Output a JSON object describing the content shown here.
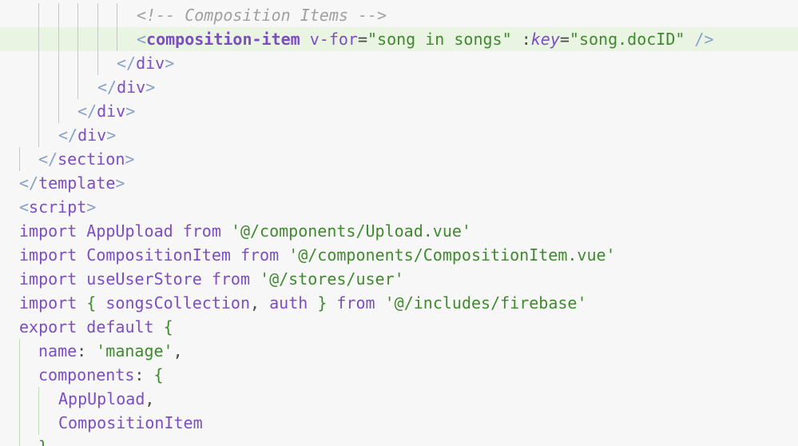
{
  "editor": {
    "line1": {
      "comment": "<!-- Composition Items -->"
    },
    "line2": {
      "open": "<",
      "tag": "composition-item",
      "attr1": "v-for",
      "eq1": "=",
      "val1": "\"song in songs\"",
      "colon": ":",
      "attr2": "key",
      "eq2": "=",
      "val2": "\"song.docID\"",
      "close": "/>"
    },
    "line3": {
      "open": "</",
      "tag": "div",
      "close": ">"
    },
    "line4": {
      "open": "</",
      "tag": "div",
      "close": ">"
    },
    "line5": {
      "open": "</",
      "tag": "div",
      "close": ">"
    },
    "line6": {
      "open": "</",
      "tag": "div",
      "close": ">"
    },
    "line7": {
      "open": "</",
      "tag": "section",
      "close": ">"
    },
    "line8": {
      "open": "</",
      "tag": "template",
      "close": ">"
    },
    "line9": {
      "open": "<",
      "tag": "script",
      "close": ">"
    },
    "line10": {
      "kw1": "import",
      "ident": "AppUpload",
      "kw2": "from",
      "str": "'@/components/Upload.vue'"
    },
    "line11": {
      "kw1": "import",
      "ident": "CompositionItem",
      "kw2": "from",
      "str": "'@/components/CompositionItem.vue'"
    },
    "line12": {
      "kw1": "import",
      "ident": "useUserStore",
      "kw2": "from",
      "str": "'@/stores/user'"
    },
    "line13": {
      "kw1": "import",
      "brace_open": "{",
      "ident1": "songsCollection",
      "comma": ",",
      "ident2": "auth",
      "brace_close": "}",
      "kw2": "from",
      "str": "'@/includes/firebase'"
    },
    "line14": {
      "kw1": "export",
      "kw2": "default",
      "brace": "{"
    },
    "line15": {
      "prop": "name",
      "colon": ":",
      "str": "'manage'",
      "comma": ","
    },
    "line16": {
      "prop": "components",
      "colon": ":",
      "brace": "{"
    },
    "line17": {
      "ident": "AppUpload",
      "comma": ","
    },
    "line18": {
      "ident": "CompositionItem"
    },
    "line19": {
      "brace": "}"
    }
  },
  "colors": {
    "background": "#f7f7f7",
    "highlight_line": "#e9f4e2",
    "keyword": "#7c4dc4",
    "string": "#3f8a2e",
    "comment": "#a0a0a0",
    "bracket": "#87a1c7"
  }
}
